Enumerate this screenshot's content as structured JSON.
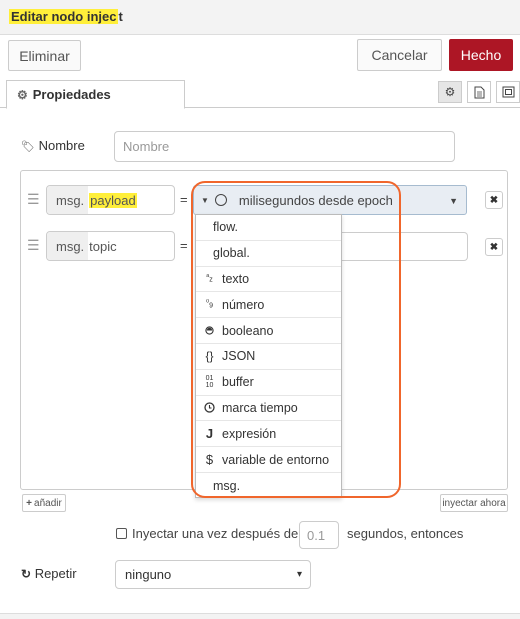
{
  "dialog": {
    "title_highlighted": "Editar nodo injec",
    "title_rest": "t"
  },
  "buttons": {
    "delete": "Eliminar",
    "cancel": "Cancelar",
    "done": "Hecho"
  },
  "tabs": {
    "properties": "Propiedades",
    "icons": [
      "gear-icon",
      "description-icon",
      "appearance-icon"
    ]
  },
  "form": {
    "name_label": "Nombre",
    "name_placeholder": "Nombre",
    "rows": [
      {
        "prefix": "msg.",
        "property": "payload",
        "equals": "=",
        "type_label": "milisegundos desde epoch"
      },
      {
        "prefix": "msg.",
        "property": "topic",
        "equals": "="
      }
    ],
    "add_label": "añadir",
    "inject_now": "inyectar ahora",
    "once_label": "Inyectar una vez después de",
    "once_value": "0.1",
    "once_suffix": "segundos, entonces",
    "repeat_label": "Repetir",
    "repeat_value": "ninguno"
  },
  "type_menu": [
    {
      "label": "flow.",
      "icon": ""
    },
    {
      "label": "global.",
      "icon": ""
    },
    {
      "label": "texto",
      "icon": "string-icon"
    },
    {
      "label": "número",
      "icon": "number-icon"
    },
    {
      "label": "booleano",
      "icon": "boolean-icon"
    },
    {
      "label": "JSON",
      "icon": "json-icon"
    },
    {
      "label": "buffer",
      "icon": "buffer-icon"
    },
    {
      "label": "marca tiempo",
      "icon": "clock-icon"
    },
    {
      "label": "expresión",
      "icon": "expression-icon"
    },
    {
      "label": "variable de entorno",
      "icon": "env-icon"
    },
    {
      "label": "msg.",
      "icon": ""
    }
  ],
  "colors": {
    "highlight": "#ffef3a",
    "primary_button": "#ad1625",
    "annotation": "#f0662c"
  }
}
